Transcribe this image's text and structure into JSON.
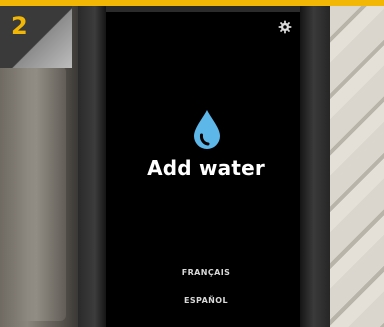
{
  "step": {
    "number": "2"
  },
  "screen": {
    "title": "Add water",
    "settings_icon": "gear-icon",
    "status_icon": "water-drop-icon",
    "languages": [
      "FRANÇAIS",
      "ESPAÑOL"
    ]
  },
  "colors": {
    "accent": "#f2b705",
    "screen_background": "#000000",
    "icon_blue": "#5db7e8",
    "text": "#ffffff"
  }
}
